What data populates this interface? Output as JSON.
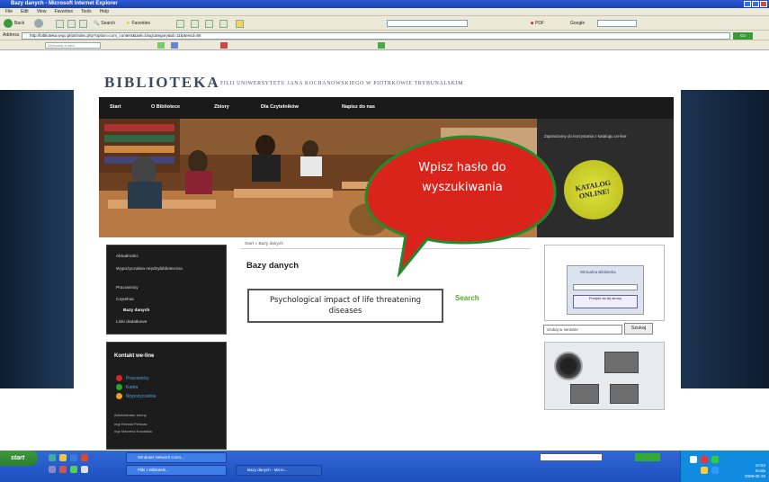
{
  "window": {
    "title": "Bazy danych - Microsoft Internet Explorer"
  },
  "menubar": {
    "items": [
      "File",
      "Edit",
      "View",
      "Favorites",
      "Tools",
      "Help"
    ]
  },
  "toolbar": {
    "back_label": "Back",
    "search_label": "Search",
    "favorites_label": "Favorites",
    "pdf_label": "PDF",
    "google_label": "Google"
  },
  "address": {
    "label": "Address",
    "url": "http://biblioteka.wsjo.pl/pt/index.php?option=com_content&task=blogcategory&id=11&Itemid=56",
    "go_label": "Go"
  },
  "links": {
    "search_placeholder": "Wyszukaj w sieci"
  },
  "site": {
    "logo": "BIBLIOTEKA",
    "subtitle": "FILII UNIWERSYTETU JANA KOCHANOWSKIEGO W PIOTRKOWIE TRYBUNALSKIM",
    "nav": [
      "Start",
      "O Bibliotece",
      "Zbiory",
      "Dla Czytelników",
      "Napisz do nas"
    ],
    "hero_side_text": "Zapraszamy do korzystania z katalogu on-line",
    "katalog_badge": "KATALOG ONLINE!",
    "menu": [
      "Aktualności",
      "Wypożyczalnia międzybiblioteczna",
      "Pracownicy",
      "Czytelnia",
      "Bazy danych",
      "Linki dodatkowe"
    ],
    "menu_active": "Bazy danych",
    "contact": {
      "title": "Kontakt we-line",
      "items": [
        "Pracownicy",
        "Kadra",
        "Wypożyczalnia"
      ],
      "footer_label": "Administrator strony",
      "footer_lines": [
        "mgr Renata Pietrzak",
        "mgr Marzena Kowalska"
      ]
    },
    "breadcrumb": "Start » Bazy danych",
    "content_title": "Bazy danych",
    "query_text": "Psychological impact of life threatening diseases",
    "search_link": "Search",
    "login": {
      "header": "Wirtualna Biblioteka",
      "button": "Przejdź do tej strony"
    },
    "site_search_value": "szukaj w serwisie",
    "site_search_button": "Szukaj"
  },
  "annotation": {
    "bubble_text": "Wpisz hasło do wyszukiwania",
    "bubble_fill": "#d9241b",
    "bubble_border": "#1f8c2b"
  },
  "taskbar": {
    "start_label": "start",
    "tasks": [
      "Windows Network Conn...",
      "Pliki z Biblioteki...",
      "Bazy danych - Micro..."
    ],
    "clock_time": "10:52",
    "clock_day": "środa",
    "clock_date": "2009-05-26"
  },
  "colors": {
    "nav_bg": "#1a1a1a",
    "accent_green": "#5aa832",
    "katalog_yellow": "#d2d428"
  }
}
